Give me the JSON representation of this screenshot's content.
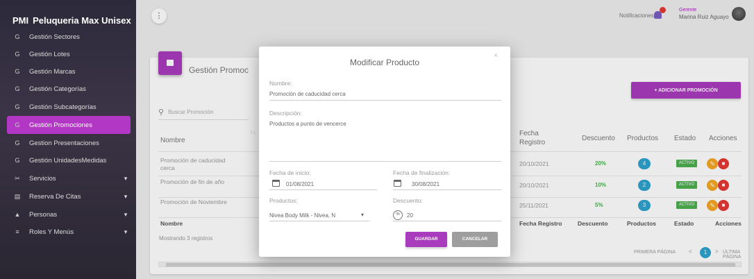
{
  "brand": {
    "mini": "PMI",
    "name": "Peluqueria Max Unisex"
  },
  "sidebar": {
    "items": [
      {
        "label": "Gestión Sectores",
        "icon": "G",
        "caret": ""
      },
      {
        "label": "Gestión Lotes",
        "icon": "G",
        "caret": ""
      },
      {
        "label": "Gestión Marcas",
        "icon": "G",
        "caret": ""
      },
      {
        "label": "Gestión Categorías",
        "icon": "G",
        "caret": ""
      },
      {
        "label": "Gestión Subcategorías",
        "icon": "G",
        "caret": ""
      },
      {
        "label": "Gestión Promociones",
        "icon": "G",
        "caret": ""
      },
      {
        "label": "Gestion Presentaciones",
        "icon": "G",
        "caret": ""
      },
      {
        "label": "Gestión UnidadesMedidas",
        "icon": "G",
        "caret": ""
      },
      {
        "label": "Servicios",
        "icon": "✂",
        "caret": "▾"
      },
      {
        "label": "Reserva De Citas",
        "icon": "▤",
        "caret": "▾"
      },
      {
        "label": "Personas",
        "icon": "▲",
        "caret": "▾"
      },
      {
        "label": "Roles Y Menús",
        "icon": "≡",
        "caret": "▾"
      }
    ],
    "active_index": 5
  },
  "topbar": {
    "kebab": "⋮",
    "notifications_label": "Notificaciones",
    "user_role": "Gerente",
    "user_name": "Marina Ruiz Aguayo"
  },
  "page": {
    "card_title": "Gestión Promoc",
    "add_button": "+ ADICIONAR PROMOCIÓN",
    "search_placeholder": "Buscar Promoción"
  },
  "table": {
    "headers": {
      "nombre": "Nombre",
      "fecha_registro_1": "Fecha",
      "fecha_registro_2": "Registro",
      "descuento": "Descuento",
      "productos": "Productos",
      "estado": "Estado",
      "acciones": "Acciones"
    },
    "rows": [
      {
        "nombre_1": "Promoción de caducidad",
        "nombre_2": "cerca",
        "fecha": "20/10/2021",
        "descuento": "20%",
        "productos": "4",
        "estado": "ACTIVO"
      },
      {
        "nombre_1": "Promoción de fin de año",
        "nombre_2": "",
        "fecha": "20/10/2021",
        "descuento": "10%",
        "productos": "2",
        "estado": "ACTIVO"
      },
      {
        "nombre_1": "Promoción de Noviembre",
        "nombre_2": "",
        "fecha": "25/11/2021",
        "descuento": "5%",
        "productos": "3",
        "estado": "ACTIVO"
      }
    ],
    "footer": {
      "nombre": "Nombre",
      "fecha": "Fecha Registro",
      "descuento": "Descuento",
      "productos": "Productos",
      "estado": "Estado",
      "acciones": "Acciones"
    },
    "showing": "Mostrando 3 registros"
  },
  "pagination": {
    "first": "PRIMERA PÁGINA",
    "prev": "<",
    "current": "1",
    "next": ">",
    "last": "ÚLTIMA PÁGINA"
  },
  "modal": {
    "title": "Modificar Producto",
    "close": "×",
    "nombre_label": "Nombre:",
    "nombre_value": "Promoción de caducidad cerca",
    "descripcion_label": "Descripción:",
    "descripcion_value": "Productos a punto de vencerce",
    "fecha_inicio_label": "Fecha de inicio:",
    "fecha_inicio_value": "01/08/2021",
    "fecha_fin_label": "Fecha de finalización:",
    "fecha_fin_value": "30/08/2021",
    "productos_label": "Productos:",
    "productos_value": "Nivea Body Milk - Nivea, N",
    "descuento_label": "Descuento:",
    "descuento_value": "20",
    "save_label": "GUARDAR",
    "cancel_label": "CANCELAR"
  }
}
